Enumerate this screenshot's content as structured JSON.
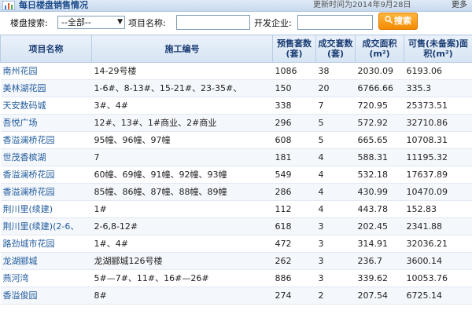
{
  "header": {
    "title": "每日楼盘销售情况",
    "updated": "更新时间为2014年9月28日",
    "more": "更多>>",
    "icon": "chart-bars-icon"
  },
  "search": {
    "district_label": "楼盘搜索:",
    "district_value": "--全部--",
    "project_label": "项目名称:",
    "project_value": "",
    "developer_label": "开发企业:",
    "developer_value": "",
    "button_label": "搜索"
  },
  "table": {
    "columns": [
      "项目名称",
      "施工编号",
      "预售套数(套)",
      "成交套数(套)",
      "成交面积(m²)",
      "可售(未备案)面积(m²)"
    ],
    "rows": [
      [
        "南州花园",
        "14-29号楼",
        "1086",
        "38",
        "2030.09",
        "6193.06"
      ],
      [
        "美林湖花园",
        "1-6#、8-13#、15-21#、23-35#、",
        "150",
        "20",
        "6766.66",
        "335.3"
      ],
      [
        "天安数码城",
        "3#、4#",
        "338",
        "7",
        "720.95",
        "25373.51"
      ],
      [
        "吾悦广场",
        "12#、13#、1#商业、2#商业",
        "296",
        "5",
        "572.92",
        "32710.86"
      ],
      [
        "香溢澜桥花园",
        "95幢、96幢、97幢",
        "608",
        "5",
        "665.65",
        "10708.31"
      ],
      [
        "世茂香槟湖",
        "7",
        "181",
        "4",
        "588.31",
        "11195.32"
      ],
      [
        "香溢澜桥花园",
        "60幢、69幢、91幢、92幢、93幢",
        "549",
        "4",
        "532.18",
        "17637.89"
      ],
      [
        "香溢澜桥花园",
        "85幢、86幢、87幢、88幢、89幢",
        "286",
        "4",
        "430.99",
        "10470.09"
      ],
      [
        "荆川里(续建)",
        "1#",
        "112",
        "4",
        "443.78",
        "152.83"
      ],
      [
        "荆川里(续建)(2-6、",
        "2-6,8-12#",
        "618",
        "3",
        "202.45",
        "2341.88"
      ],
      [
        "路劲城市花园",
        "1#、4#",
        "472",
        "3",
        "314.91",
        "32036.21"
      ],
      [
        "龙湖郦城",
        "龙湖郦城126号楼",
        "262",
        "3",
        "236.7",
        "3600.14"
      ],
      [
        "燕河湾",
        "5#—7#、11#、16#—26#",
        "886",
        "3",
        "339.62",
        "10053.76"
      ],
      [
        "香溢俊园",
        "8#",
        "274",
        "2",
        "207.54",
        "6725.14"
      ]
    ]
  },
  "colors": {
    "header_text": "#1b3d74",
    "link_text": "#1f5a9c",
    "button": "#f38b00"
  }
}
